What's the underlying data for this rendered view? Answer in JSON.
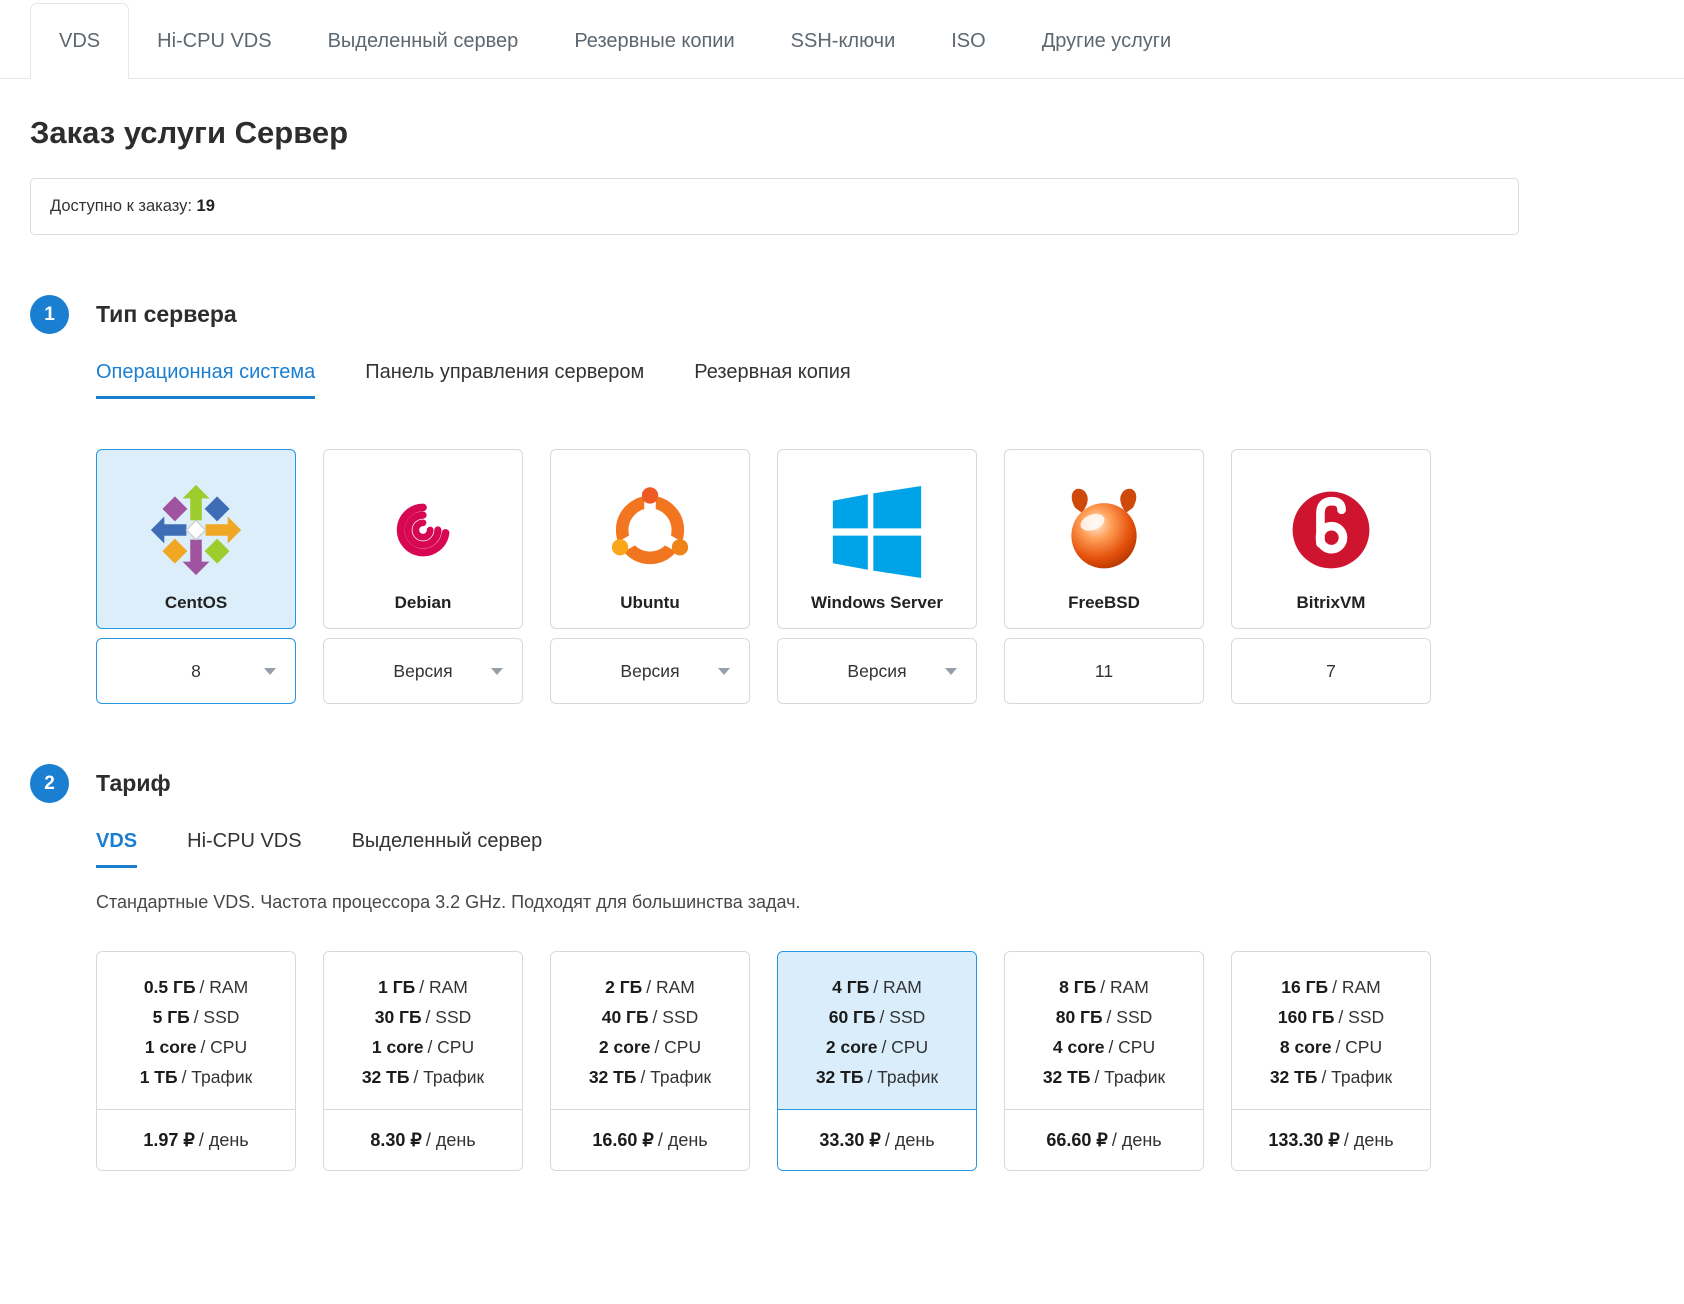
{
  "colors": {
    "accent": "#1a7fd1",
    "selected_border": "#2596e0",
    "selected_bg": "#ddeefb"
  },
  "top_tabs": [
    {
      "label": "VDS",
      "active": true
    },
    {
      "label": "Hi-CPU VDS",
      "active": false
    },
    {
      "label": "Выделенный сервер",
      "active": false
    },
    {
      "label": "Резервные копии",
      "active": false
    },
    {
      "label": "SSH-ключи",
      "active": false
    },
    {
      "label": "ISO",
      "active": false
    },
    {
      "label": "Другие услуги",
      "active": false
    }
  ],
  "page_title": "Заказ услуги Сервер",
  "availability": {
    "label": "Доступно к заказу: ",
    "value": "19"
  },
  "section1": {
    "number": "1",
    "title": "Тип сервера",
    "tabs": [
      {
        "label": "Операционная система",
        "active": true
      },
      {
        "label": "Панель управления сервером",
        "active": false
      },
      {
        "label": "Резервная копия",
        "active": false
      }
    ],
    "os_cards": [
      {
        "name": "CentOS",
        "version": "8",
        "has_dropdown": true,
        "selected": true,
        "icon": "centos-icon"
      },
      {
        "name": "Debian",
        "version": "Версия",
        "has_dropdown": true,
        "selected": false,
        "icon": "debian-icon"
      },
      {
        "name": "Ubuntu",
        "version": "Версия",
        "has_dropdown": true,
        "selected": false,
        "icon": "ubuntu-icon"
      },
      {
        "name": "Windows Server",
        "version": "Версия",
        "has_dropdown": true,
        "selected": false,
        "icon": "windows-icon"
      },
      {
        "name": "FreeBSD",
        "version": "11",
        "has_dropdown": false,
        "selected": false,
        "icon": "freebsd-icon"
      },
      {
        "name": "BitrixVM",
        "version": "7",
        "has_dropdown": false,
        "selected": false,
        "icon": "bitrixvm-icon"
      }
    ]
  },
  "section2": {
    "number": "2",
    "title": "Тариф",
    "tabs": [
      {
        "label": "VDS",
        "active": true
      },
      {
        "label": "Hi-CPU VDS",
        "active": false
      },
      {
        "label": "Выделенный сервер",
        "active": false
      }
    ],
    "description": "Стандартные VDS. Частота процессора 3.2 GHz. Подходят для большинства задач.",
    "plans": [
      {
        "selected": false,
        "specs": [
          {
            "v": "0.5 ГБ",
            "l": "/ RAM"
          },
          {
            "v": "5 ГБ",
            "l": "/ SSD"
          },
          {
            "v": "1 core",
            "l": "/ CPU"
          },
          {
            "v": "1 ТБ",
            "l": "/ Трафик"
          }
        ],
        "price": {
          "v": "1.97 ₽",
          "l": "/ день"
        }
      },
      {
        "selected": false,
        "specs": [
          {
            "v": "1 ГБ",
            "l": "/ RAM"
          },
          {
            "v": "30 ГБ",
            "l": "/ SSD"
          },
          {
            "v": "1 core",
            "l": "/ CPU"
          },
          {
            "v": "32 ТБ",
            "l": "/ Трафик"
          }
        ],
        "price": {
          "v": "8.30 ₽",
          "l": "/ день"
        }
      },
      {
        "selected": false,
        "specs": [
          {
            "v": "2 ГБ",
            "l": "/ RAM"
          },
          {
            "v": "40 ГБ",
            "l": "/ SSD"
          },
          {
            "v": "2 core",
            "l": "/ CPU"
          },
          {
            "v": "32 ТБ",
            "l": "/ Трафик"
          }
        ],
        "price": {
          "v": "16.60 ₽",
          "l": "/ день"
        }
      },
      {
        "selected": true,
        "specs": [
          {
            "v": "4 ГБ",
            "l": "/ RAM"
          },
          {
            "v": "60 ГБ",
            "l": "/ SSD"
          },
          {
            "v": "2 core",
            "l": "/ CPU"
          },
          {
            "v": "32 ТБ",
            "l": "/ Трафик"
          }
        ],
        "price": {
          "v": "33.30 ₽",
          "l": "/ день"
        }
      },
      {
        "selected": false,
        "specs": [
          {
            "v": "8 ГБ",
            "l": "/ RAM"
          },
          {
            "v": "80 ГБ",
            "l": "/ SSD"
          },
          {
            "v": "4 core",
            "l": "/ CPU"
          },
          {
            "v": "32 ТБ",
            "l": "/ Трафик"
          }
        ],
        "price": {
          "v": "66.60 ₽",
          "l": "/ день"
        }
      },
      {
        "selected": false,
        "specs": [
          {
            "v": "16 ГБ",
            "l": "/ RAM"
          },
          {
            "v": "160 ГБ",
            "l": "/ SSD"
          },
          {
            "v": "8 core",
            "l": "/ CPU"
          },
          {
            "v": "32 ТБ",
            "l": "/ Трафик"
          }
        ],
        "price": {
          "v": "133.30 ₽",
          "l": "/ день"
        }
      }
    ]
  }
}
